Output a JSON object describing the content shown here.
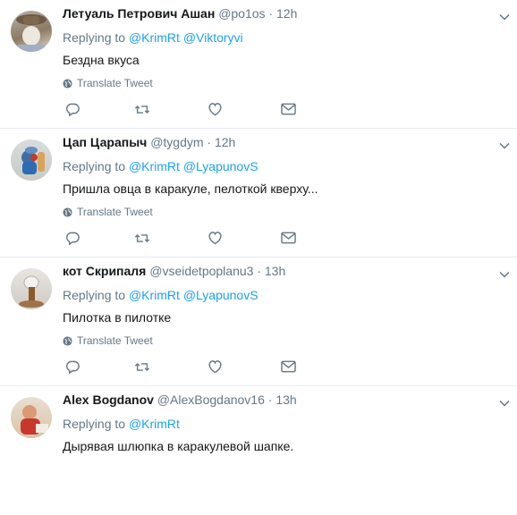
{
  "tweets": [
    {
      "name": "Летуаль Петрович Ашан",
      "handle": "@po1os",
      "dot": "·",
      "time": "12h",
      "replying_prefix": "Replying to",
      "mentions": [
        "@KrimRt",
        "@Viktoryvi"
      ],
      "text": "Бездна вкуса",
      "translate": "Translate Tweet"
    },
    {
      "name": "Цап Царапыч",
      "handle": "@tygdym",
      "dot": "·",
      "time": "12h",
      "replying_prefix": "Replying to",
      "mentions": [
        "@KrimRt",
        "@LyapunovS"
      ],
      "text": "Пришла овца в каракуле, пелоткой кверху...",
      "translate": "Translate Tweet"
    },
    {
      "name": "кот Скрипаля",
      "handle": "@vseidetpoplanu3",
      "dot": "·",
      "time": "13h",
      "replying_prefix": "Replying to",
      "mentions": [
        "@KrimRt",
        "@LyapunovS"
      ],
      "text": "Пилотка в пилотке",
      "translate": "Translate Tweet"
    },
    {
      "name": "Alex Bogdanov",
      "handle": "@AlexBogdanov16",
      "dot": "·",
      "time": "13h",
      "replying_prefix": "Replying to",
      "mentions": [
        "@KrimRt"
      ],
      "text": "Дырявая шлюпка в каракулевой шапке."
    }
  ],
  "icons": {
    "reply": "reply-icon",
    "retweet": "retweet-icon",
    "like": "heart-icon",
    "dm": "envelope-icon",
    "globe": "globe-icon",
    "more": "chevron-down-icon"
  },
  "colors": {
    "link": "#1da1f2",
    "muted": "#657786",
    "text": "#14171a",
    "divider": "#e6ecf0"
  }
}
